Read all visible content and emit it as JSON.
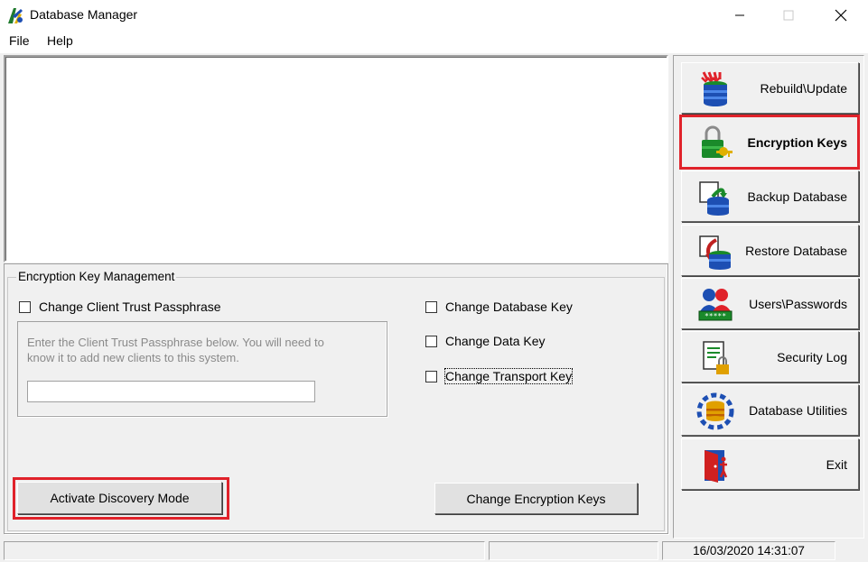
{
  "window": {
    "title": "Database Manager"
  },
  "menu": {
    "file": "File",
    "help": "Help"
  },
  "log_area": {
    "content": ""
  },
  "encryption_panel": {
    "legend": "Encryption Key Management",
    "client_trust": {
      "label": "Change Client Trust Passphrase",
      "checked": false
    },
    "passphrase_hint": "Enter the Client Trust Passphrase below.  You will need to know it to add new clients to this system.",
    "passphrase_value": "",
    "database_key": {
      "label": "Change Database Key",
      "checked": false
    },
    "data_key": {
      "label": "Change Data Key",
      "checked": false
    },
    "transport_key": {
      "label": "Change Transport Key",
      "checked": false
    },
    "activate_discovery_label": "Activate Discovery Mode",
    "change_keys_label": "Change Encryption Keys"
  },
  "sidebar": {
    "items": [
      {
        "label": "Rebuild\\Update",
        "icon": "rebuild-database-icon"
      },
      {
        "label": "Encryption Keys",
        "icon": "encryption-keys-icon",
        "selected": true
      },
      {
        "label": "Backup Database",
        "icon": "backup-database-icon"
      },
      {
        "label": "Restore Database",
        "icon": "restore-database-icon"
      },
      {
        "label": "Users\\Passwords",
        "icon": "users-passwords-icon"
      },
      {
        "label": "Security Log",
        "icon": "security-log-icon"
      },
      {
        "label": "Database Utilities",
        "icon": "database-utilities-icon"
      },
      {
        "label": "Exit",
        "icon": "exit-door-icon"
      }
    ]
  },
  "statusbar": {
    "datetime": "16/03/2020 14:31:07"
  },
  "colors": {
    "highlight": "#e0222a",
    "window_bg": "#f0f0f0"
  }
}
